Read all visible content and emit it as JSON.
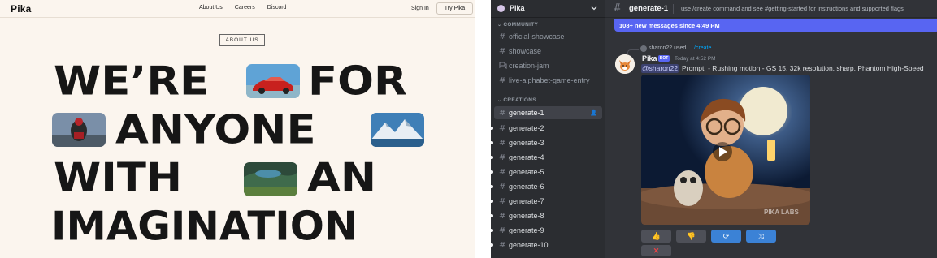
{
  "site": {
    "logo": "Pika",
    "nav": [
      "About Us",
      "Careers",
      "Discord"
    ],
    "sign_in": "Sign In",
    "try_button": "Try Pika",
    "about_badge": "ABOUT US",
    "hero": {
      "w1": "WE’RE",
      "w2": "FOR",
      "line2": "ANYONE",
      "w3": "WITH",
      "w4": "AN",
      "line4": "IMAGINATION"
    }
  },
  "discord": {
    "server_name": "Pika",
    "categories": {
      "community": "COMMUNITY",
      "creations": "CREATIONS"
    },
    "community_channels": [
      "official-showcase",
      "showcase",
      "creation-jam",
      "live-alphabet-game-entry"
    ],
    "creation_channels": [
      "generate-1",
      "generate-2",
      "generate-3",
      "generate-4",
      "generate-5",
      "generate-6",
      "generate-7",
      "generate-8",
      "generate-9",
      "generate-10"
    ],
    "active_channel": "generate-1",
    "topic": "use /create command and see #getting-started for instructions and supported flags",
    "new_messages": "108+ new messages since 4:49 PM",
    "message": {
      "reply_user": "sharon22 used",
      "reply_command": "/create",
      "author": "Pika",
      "badge": "BOT",
      "timestamp": "Today at 4:52 PM",
      "mention": "@sharon22",
      "prompt": "Prompt: - Rushing motion - GS 15, 32k resolution, sharp, Phantom High-Speed",
      "watermark": "PIKA LABS"
    },
    "reactions": [
      "thumbs-up",
      "thumbs-down",
      "repeat",
      "shuffle",
      "delete"
    ]
  },
  "colors": {
    "site_bg": "#fbf5ee",
    "discord_bg": "#313338",
    "sidebar_bg": "#2b2d31",
    "blurple": "#5865f2",
    "link": "#00a8fc"
  }
}
